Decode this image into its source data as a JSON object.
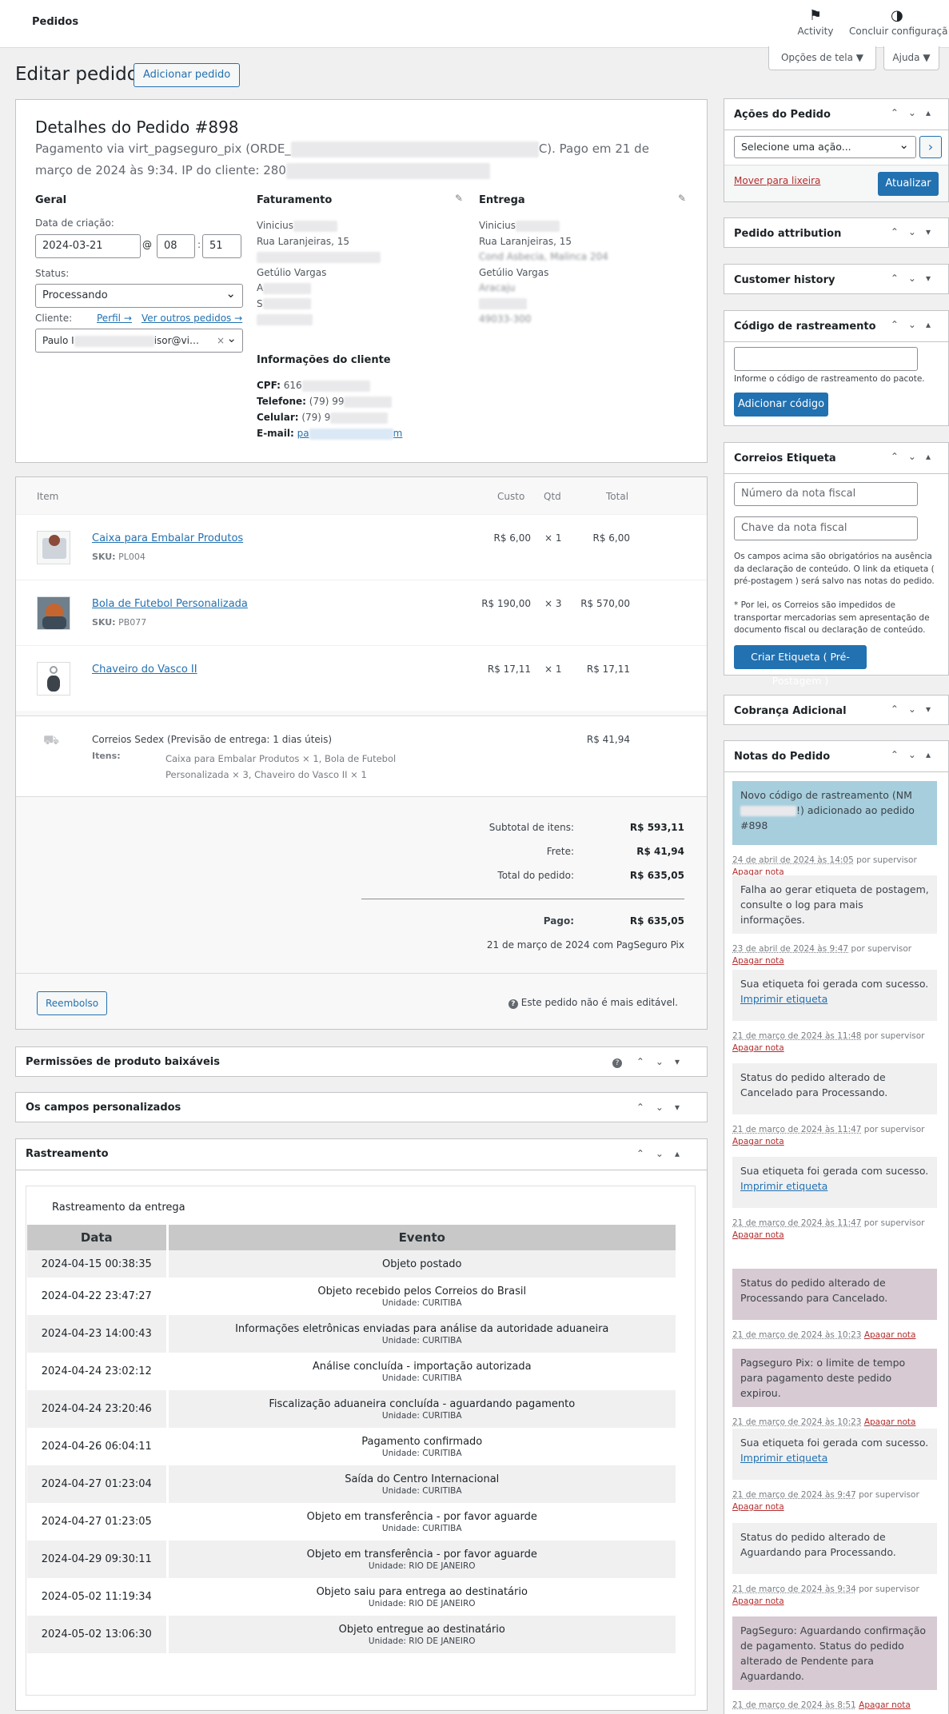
{
  "topbar": {
    "title": "Pedidos",
    "activity": "Activity",
    "finish_setup": "Concluir configuraçã"
  },
  "screen_options": {
    "screen": "Opções de tela ▼",
    "help": "Ajuda ▼"
  },
  "page": {
    "title": "Editar pedido",
    "add_order": "Adicionar pedido"
  },
  "order": {
    "heading": "Detalhes do Pedido #898",
    "payment_line_1": "Pagamento via virt_pagseguro_pix (ORDE_",
    "payment_line_1_end": "C). Pago em 21 de",
    "payment_line_2": "março de 2024 às 9:34. IP do cliente: 280",
    "general": {
      "title": "Geral",
      "created_label": "Data de criação:",
      "date": "2024-03-21",
      "at": "@",
      "hour": "08",
      "colon": ":",
      "minute": "51",
      "status_label": "Status:",
      "status": "Processando",
      "customer_label": "Cliente:",
      "profile_link": "Perfil →",
      "other_orders_link": "Ver outros pedidos →",
      "customer_start": "Paulo I",
      "customer_end": "isor@vi…",
      "clear": "×"
    },
    "billing": {
      "title": "Faturamento",
      "name": "Vinicius",
      "street": "Rua Laranjeiras, 15",
      "city": "Getúlio Vargas",
      "l1": "A",
      "l2": "S",
      "l3": "49033-300"
    },
    "shipping": {
      "title": "Entrega",
      "name": "Vinicius",
      "street": "Rua Laranjeiras, 15",
      "complement": "Cond Asbecia, Malinca 204",
      "city": "Getúlio Vargas",
      "state": "Aracaju",
      "zip": "49033-300"
    },
    "customer_info": {
      "title": "Informações do cliente",
      "cpf_label": "CPF:",
      "cpf": "616",
      "phone_label": "Telefone:",
      "phone": "(79) 99",
      "cell_label": "Celular:",
      "cell": "(79) 9",
      "email_label": "E-mail:",
      "email_start": "pa",
      "email_end": "m"
    }
  },
  "items": {
    "headers": {
      "item": "Item",
      "cost": "Custo",
      "qty": "Qtd",
      "total": "Total"
    },
    "rows": [
      {
        "name": "Caixa para Embalar Produtos",
        "sku_label": "SKU:",
        "sku": "PL004",
        "cost": "R$ 6,00",
        "qty": "× 1",
        "total": "R$ 6,00"
      },
      {
        "name": "Bola de Futebol Personalizada",
        "sku_label": "SKU:",
        "sku": "PB077",
        "cost": "R$ 190,00",
        "qty": "× 3",
        "total": "R$ 570,00"
      },
      {
        "name": "Chaveiro do Vasco II",
        "sku_label": "",
        "sku": "",
        "cost": "R$ 17,11",
        "qty": "× 1",
        "total": "R$ 17,11"
      }
    ],
    "shipping": {
      "method": "Correios Sedex (Previsão de entrega: 1 dias úteis)",
      "items_label": "Itens:",
      "items_line1": "Caixa para Embalar Produtos × 1, Bola de Futebol",
      "items_line2": "Personalizada × 3, Chaveiro do Vasco II × 1",
      "total": "R$ 41,94"
    },
    "totals": {
      "subtotal_label": "Subtotal de itens:",
      "subtotal": "R$ 593,11",
      "shipping_label": "Frete:",
      "shipping": "R$ 41,94",
      "order_label": "Total do pedido:",
      "order": "R$ 635,05",
      "paid_label": "Pago:",
      "paid": "R$ 635,05",
      "paid_info": "21 de março de 2024 com PagSeguro Pix"
    },
    "refund_button": "Reembolso",
    "not_editable": "Este pedido não é mais editável."
  },
  "panels": {
    "downloads": "Permissões de produto baixáveis",
    "custom_fields": "Os campos personalizados",
    "tracking": "Rastreamento"
  },
  "tracking": {
    "subtitle": "Rastreamento da entrega",
    "col_date": "Data",
    "col_event": "Evento",
    "rows": [
      {
        "date": "2024-04-15 00:38:35",
        "event": "Objeto postado",
        "unit": ""
      },
      {
        "date": "2024-04-22 23:47:27",
        "event": "Objeto recebido pelos Correios do Brasil",
        "unit": "Unidade: CURITIBA"
      },
      {
        "date": "2024-04-23 14:00:43",
        "event": "Informações eletrônicas enviadas para análise da autoridade aduaneira",
        "unit": "Unidade: CURITIBA"
      },
      {
        "date": "2024-04-24 23:02:12",
        "event": "Análise concluída - importação autorizada",
        "unit": "Unidade: CURITIBA"
      },
      {
        "date": "2024-04-24 23:20:46",
        "event": "Fiscalização aduaneira concluída - aguardando pagamento",
        "unit": "Unidade: CURITIBA"
      },
      {
        "date": "2024-04-26 06:04:11",
        "event": "Pagamento confirmado",
        "unit": "Unidade: CURITIBA"
      },
      {
        "date": "2024-04-27 01:23:04",
        "event": "Saída do Centro Internacional",
        "unit": "Unidade: CURITIBA"
      },
      {
        "date": "2024-04-27 01:23:05",
        "event": "Objeto em transferência - por favor aguarde",
        "unit": "Unidade: CURITIBA"
      },
      {
        "date": "2024-04-29 09:30:11",
        "event": "Objeto em transferência - por favor aguarde",
        "unit": "Unidade: RIO DE JANEIRO"
      },
      {
        "date": "2024-05-02 11:19:34",
        "event": "Objeto saiu para entrega ao destinatário",
        "unit": "Unidade: RIO DE JANEIRO"
      },
      {
        "date": "2024-05-02 13:06:30",
        "event": "Objeto entregue ao destinatário",
        "unit": "Unidade: RIO DE JANEIRO"
      }
    ]
  },
  "sidebar": {
    "actions": {
      "title": "Ações do Pedido",
      "select": "Selecione uma ação...",
      "go": "›",
      "trash": "Mover para lixeira",
      "update": "Atualizar"
    },
    "attribution": {
      "title": "Pedido attribution"
    },
    "history": {
      "title": "Customer history"
    },
    "tracking_code": {
      "title": "Código de rastreamento",
      "hint": "Informe o código de rastreamento do pacote.",
      "button": "Adicionar código"
    },
    "label": {
      "title": "Correios Etiqueta",
      "invoice_number_placeholder": "Número da nota fiscal",
      "invoice_key_placeholder": "Chave da nota fiscal",
      "info1": "Os campos acima são obrigatórios na ausência da declaração de conteúdo. O link da etiqueta ( pré-postagem ) será salvo nas notas do pedido.",
      "info2": "* Por lei, os Correios são impedidos de transportar mercadorias sem apresentação de documento fiscal ou declaração de conteúdo.",
      "button": "Criar Etiqueta ( Pré-Postagem )"
    },
    "extra_charge": {
      "title": "Cobrança Adicional"
    },
    "notes": {
      "title": "Notas do Pedido",
      "items": [
        {
          "text": "Novo código de rastreamento (NM",
          "text_end": "!) adicionado ao pedido #898",
          "date": "24 de abril de 2024 às 14:05",
          "by": " por supervisor",
          "delete": "Apagar nota",
          "style": "blue"
        },
        {
          "text": "Falha ao gerar etiqueta de postagem, consulte o log para mais informações.",
          "date": "23 de abril de 2024 às 9:47",
          "by": " por supervisor",
          "delete": "Apagar nota",
          "style": "gray"
        },
        {
          "text": "Sua etiqueta foi gerada com sucesso.",
          "link": "Imprimir etiqueta",
          "date": "21 de março de 2024 às 11:48",
          "by": " por supervisor",
          "delete": "Apagar nota",
          "style": "gray"
        },
        {
          "text": "Status do pedido alterado de Cancelado para Processando.",
          "date": "21 de março de 2024 às 11:47",
          "by": " por supervisor",
          "delete": "Apagar nota",
          "style": "gray"
        },
        {
          "text": "Sua etiqueta foi gerada com sucesso.",
          "link": "Imprimir etiqueta",
          "date": "21 de março de 2024 às 11:47",
          "by": " por supervisor",
          "delete": "Apagar nota",
          "style": "gray"
        },
        {
          "text": "Status do pedido alterado de Processando para Cancelado.",
          "date": "21 de março de 2024 às 10:23",
          "by": "",
          "delete": "Apagar nota",
          "style": "pink"
        },
        {
          "text": "Pagseguro Pix: o limite de tempo para pagamento deste pedido expirou.",
          "date": "21 de março de 2024 às 10:23",
          "by": "",
          "delete": "Apagar nota",
          "style": "pink"
        },
        {
          "text": "Sua etiqueta foi gerada com sucesso.",
          "link": "Imprimir etiqueta",
          "date": "21 de março de 2024 às 9:47",
          "by": " por supervisor",
          "delete": "Apagar nota",
          "style": "gray"
        },
        {
          "text": "Status do pedido alterado de Aguardando para Processando.",
          "date": "21 de março de 2024 às 9:34",
          "by": " por supervisor",
          "delete": "Apagar nota",
          "style": "gray"
        },
        {
          "text": "PagSeguro: Aguardando confirmação de pagamento. Status do pedido alterado de Pendente para Aguardando.",
          "date": "21 de março de 2024 às 8:51",
          "by": "",
          "delete": "Apagar nota",
          "style": "pink"
        }
      ]
    }
  },
  "colors": {
    "accent": "#2271b1",
    "delete": "#b32d2e",
    "note_customer": "#a7cedc",
    "note_system": "#d7cad2",
    "note_private": "#f0f0f1"
  }
}
